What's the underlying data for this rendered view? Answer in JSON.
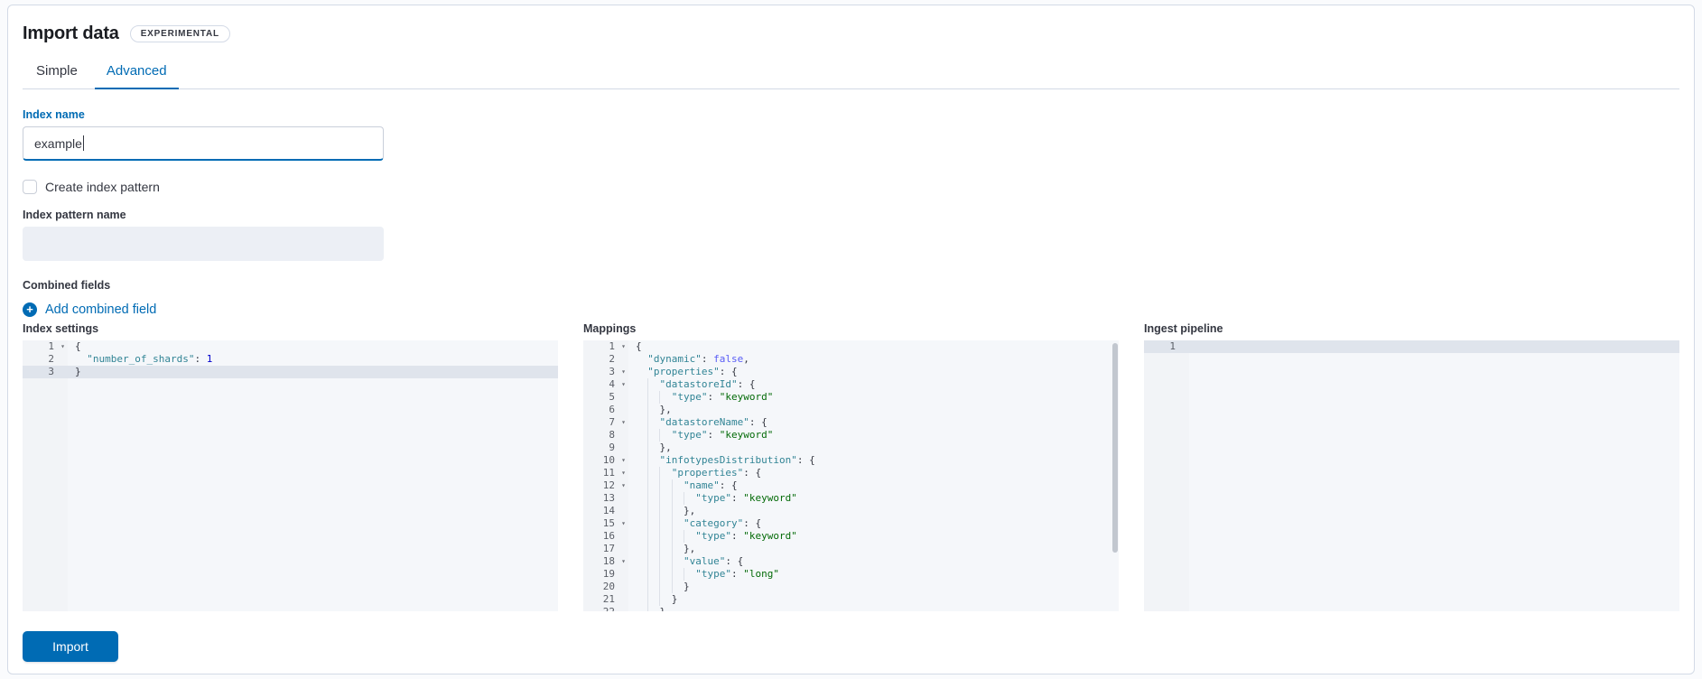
{
  "page": {
    "title": "Import data",
    "badge": "EXPERIMENTAL"
  },
  "tabs": [
    {
      "label": "Simple",
      "selected": false
    },
    {
      "label": "Advanced",
      "selected": true
    }
  ],
  "form": {
    "index_name": {
      "label": "Index name",
      "value": "example",
      "focused": true
    },
    "create_index_pattern": {
      "label": "Create index pattern",
      "checked": false
    },
    "index_pattern_name": {
      "label": "Index pattern name",
      "value": "",
      "disabled": true
    },
    "combined_fields": {
      "label": "Combined fields",
      "add_link": "Add combined field"
    }
  },
  "editors": [
    {
      "label": "Index settings",
      "active_line": 3,
      "has_scrollbar": false,
      "lines": [
        "{",
        "  \"number_of_shards\": 1",
        "}"
      ]
    },
    {
      "label": "Mappings",
      "active_line": null,
      "has_scrollbar": true,
      "lines": [
        "{",
        "  \"dynamic\": false,",
        "  \"properties\": {",
        "    \"datastoreId\": {",
        "      \"type\": \"keyword\"",
        "    },",
        "    \"datastoreName\": {",
        "      \"type\": \"keyword\"",
        "    },",
        "    \"infotypesDistribution\": {",
        "      \"properties\": {",
        "        \"name\": {",
        "          \"type\": \"keyword\"",
        "        },",
        "        \"category\": {",
        "          \"type\": \"keyword\"",
        "        },",
        "        \"value\": {",
        "          \"type\": \"long\"",
        "        }",
        "      }",
        "    }"
      ]
    },
    {
      "label": "Ingest pipeline",
      "active_line": 1,
      "has_scrollbar": false,
      "lines": [
        ""
      ]
    }
  ],
  "actions": {
    "import_label": "Import"
  },
  "colors": {
    "accent": "#006BB4",
    "editor_bg": "#f5f7fa",
    "editor_gutter_bg": "#f2f4f7",
    "editor_active_line": "#dfe4ec",
    "syntax_key": "#318495",
    "syntax_string": "#036A07",
    "syntax_number": "#0000CD",
    "syntax_boolean": "#585CF6",
    "syntax_punct": "#343741"
  }
}
